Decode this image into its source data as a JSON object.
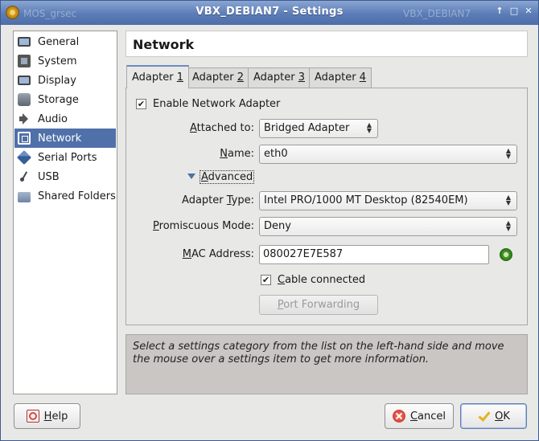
{
  "window": {
    "title": "VBX_DEBIAN7 - Settings",
    "ghost_left": "MOS_grsec",
    "ghost_right": "VBX_DEBIAN7"
  },
  "sidebar": {
    "items": [
      {
        "label": "General",
        "icon": "monitor-icon"
      },
      {
        "label": "System",
        "icon": "chip-icon"
      },
      {
        "label": "Display",
        "icon": "display-icon"
      },
      {
        "label": "Storage",
        "icon": "disk-icon"
      },
      {
        "label": "Audio",
        "icon": "speaker-icon"
      },
      {
        "label": "Network",
        "icon": "network-icon",
        "selected": true
      },
      {
        "label": "Serial Ports",
        "icon": "serial-port-icon"
      },
      {
        "label": "USB",
        "icon": "usb-icon"
      },
      {
        "label": "Shared Folders",
        "icon": "folder-icon"
      }
    ]
  },
  "page": {
    "title": "Network"
  },
  "tabs": [
    {
      "prefix": "Adapter ",
      "key": "1",
      "active": true
    },
    {
      "prefix": "Adapter ",
      "key": "2"
    },
    {
      "prefix": "Adapter ",
      "key": "3"
    },
    {
      "prefix": "Adapter ",
      "key": "4"
    }
  ],
  "adapter": {
    "enable_label": "Enable Network Adapter",
    "enable_checked": true,
    "attached_label_key": "A",
    "attached_label_rest": "ttached to:",
    "attached_value": "Bridged Adapter",
    "name_label_key": "N",
    "name_label_rest": "ame:",
    "name_value": "eth0",
    "advanced_key": "A",
    "advanced_rest": "dvanced",
    "adapter_type_label_pre": "Adapter ",
    "adapter_type_label_key": "T",
    "adapter_type_label_post": "ype:",
    "adapter_type_value": "Intel PRO/1000 MT Desktop (82540EM)",
    "promisc_label_key": "P",
    "promisc_label_rest": "romiscuous Mode:",
    "promisc_value": "Deny",
    "mac_label_key": "M",
    "mac_label_rest": "AC Address:",
    "mac_value": "080027E7E587",
    "cable_label_key": "C",
    "cable_label_rest": "able connected",
    "cable_checked": true,
    "port_forwarding_key": "P",
    "port_forwarding_rest": "ort Forwarding"
  },
  "info_text": "Select a settings category from the list on the left-hand side and move the mouse over a settings item to get more information.",
  "buttons": {
    "help_key": "H",
    "help_rest": "elp",
    "cancel_key": "C",
    "cancel_rest": "ancel",
    "ok_key": "O",
    "ok_rest": "K"
  },
  "colors": {
    "selection": "#4f70a8",
    "titlebar": "#5b7cb6"
  }
}
